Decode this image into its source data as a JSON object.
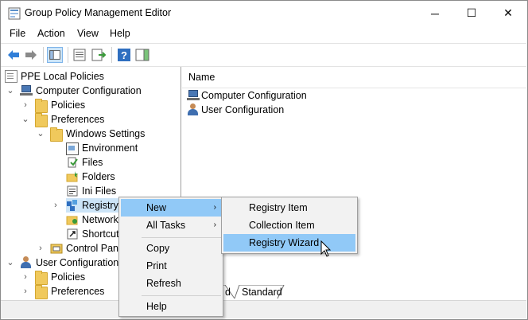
{
  "window": {
    "title": "Group Policy Management Editor",
    "controls": {
      "minimize": "─",
      "maximize": "☐",
      "close": "✕"
    }
  },
  "menu": [
    "File",
    "Action",
    "View",
    "Help"
  ],
  "toolbar": {
    "icons": [
      "back-arrow-icon",
      "forward-arrow-icon",
      "show-hide-tree-icon",
      "properties-icon",
      "export-list-icon",
      "help-icon",
      "show-action-pane-icon"
    ]
  },
  "tree": {
    "root": "PPE Local Policies",
    "computer_configuration": "Computer Configuration",
    "policies": "Policies",
    "preferences": "Preferences",
    "windows_settings": "Windows Settings",
    "environment": "Environment",
    "files": "Files",
    "folders": "Folders",
    "ini_files": "Ini Files",
    "registry": "Registry",
    "network": "Network",
    "shortcuts": "Shortcut",
    "control_panel": "Control Pan",
    "user_configuration": "User Configuration",
    "user_policies": "Policies",
    "user_preferences": "Preferences"
  },
  "list": {
    "column_name": "Name",
    "items": [
      "Computer Configuration",
      "User Configuration"
    ]
  },
  "tabs": {
    "extended_partial": "d",
    "standard": "Standard"
  },
  "context_menu": {
    "new": "New",
    "all_tasks": "All Tasks",
    "copy": "Copy",
    "print": "Print",
    "refresh": "Refresh",
    "help": "Help"
  },
  "submenu": {
    "registry_item": "Registry Item",
    "collection_item": "Collection Item",
    "registry_wizard": "Registry Wizard"
  },
  "colors": {
    "highlight": "#91c9f7",
    "menu_bg": "#f2f2f2"
  }
}
